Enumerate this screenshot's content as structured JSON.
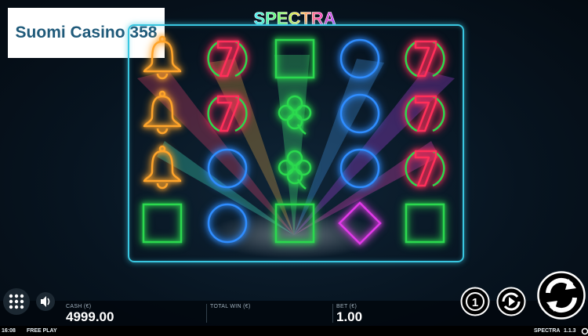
{
  "brand": {
    "label": "Suomi Casino 358"
  },
  "game": {
    "logo_text": "SPECTRA",
    "version": "1.1.3"
  },
  "reels": [
    [
      "bell",
      "bell",
      "bell",
      "square"
    ],
    [
      "seven",
      "seven",
      "circle",
      "circle"
    ],
    [
      "square",
      "clover",
      "clover",
      "square"
    ],
    [
      "circle",
      "circle",
      "circle",
      "diamond"
    ],
    [
      "seven",
      "seven",
      "seven",
      "square"
    ]
  ],
  "symbol_colors": {
    "bell": "#ffa42a",
    "seven": "#ff2f5a",
    "seven_ring": "#2bd94e",
    "circle": "#2f8dff",
    "square": "#2bd94e",
    "clover": "#2bd94e",
    "diamond": "#e13ae8"
  },
  "accent": "#39c6e0",
  "panel": {
    "cash_label": "CASH (€)",
    "cash_value": "4999.00",
    "total_win_label": "TOTAL WIN (€)",
    "total_win_value": "",
    "bet_label": "BET (€)",
    "bet_value": "1.00"
  },
  "status": {
    "time": "16:08",
    "mode": "FREE PLAY",
    "game_name": "SPECTRA",
    "version": "1.1.3"
  },
  "controls": {
    "menu_icon": "grid-dots-icon",
    "sound_icon": "speaker-icon",
    "bet_icon": "coin-1-icon",
    "autoplay_icon": "autoplay-icon",
    "spin_icon": "spin-arrows-icon"
  }
}
